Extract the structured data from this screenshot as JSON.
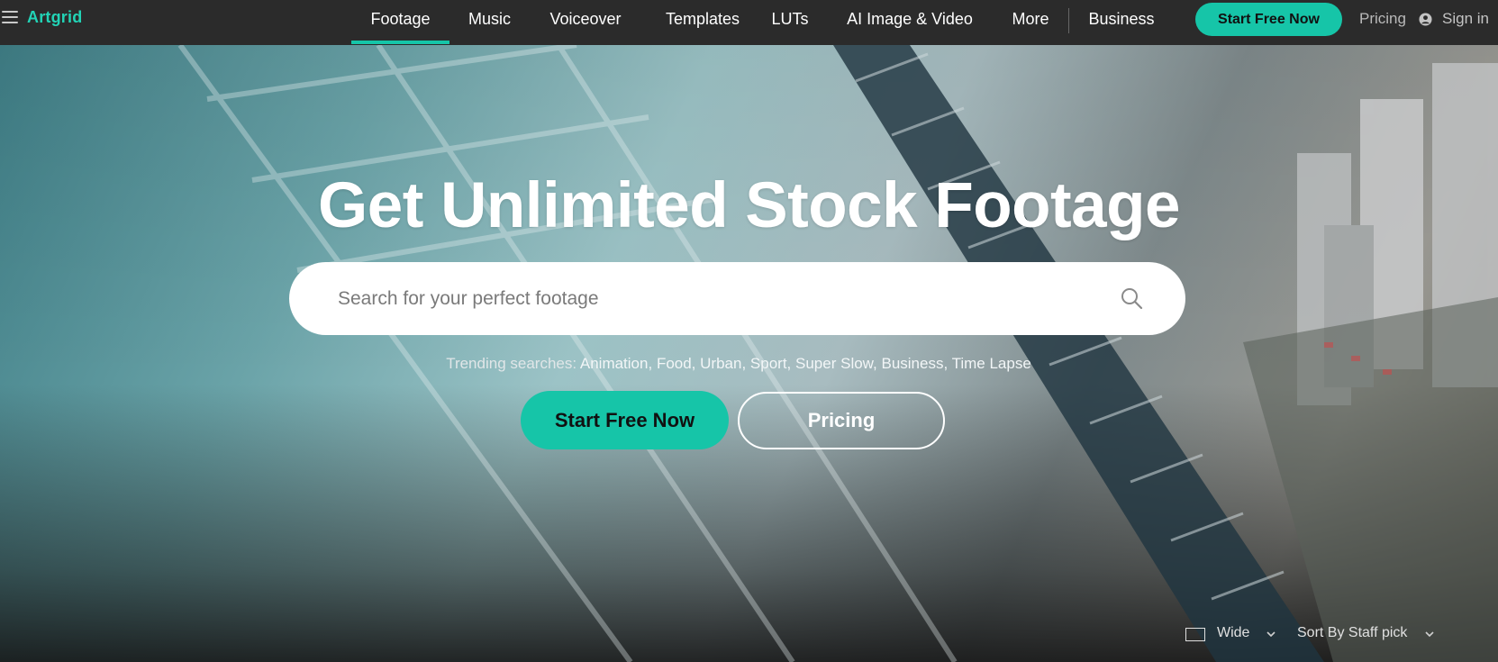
{
  "brand": {
    "logo": "Artgrid",
    "accent": "#16c5a8"
  },
  "nav": {
    "items": [
      {
        "label": "Footage",
        "active": true
      },
      {
        "label": "Music"
      },
      {
        "label": "Voiceover"
      },
      {
        "label": "Templates"
      },
      {
        "label": "LUTs"
      },
      {
        "label": "AI Image & Video"
      },
      {
        "label": "More"
      },
      {
        "label": "Business"
      }
    ],
    "start_label": "Start Free Now",
    "pricing_label": "Pricing",
    "signin_label": "Sign in",
    "icons": {
      "menu": "hamburger-icon",
      "user": "user-icon"
    }
  },
  "hero": {
    "title": "Get Unlimited Stock Footage",
    "search_placeholder": "Search for your perfect footage",
    "trending_label": "Trending searches:",
    "trending_terms": [
      "Animation,",
      "Food,",
      "Urban,",
      "Sport,",
      "Super Slow,",
      "Business,",
      "Time Lapse"
    ],
    "start_label": "Start Free Now",
    "pricing_label": "Pricing"
  },
  "controls": {
    "aspect_label": "Wide",
    "sort_label": "Sort By Staff pick"
  }
}
